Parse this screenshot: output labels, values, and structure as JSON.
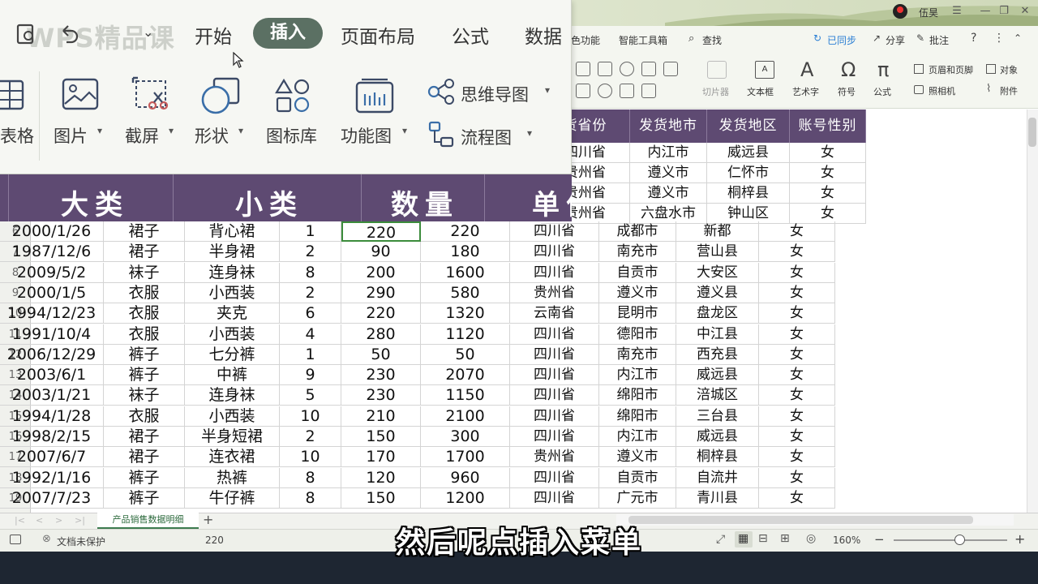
{
  "titlebar": {
    "user": "伍昊"
  },
  "ribbon_small": {
    "tabs": [
      "色功能",
      "智能工具箱",
      "查找",
      "已同步",
      "分享",
      "批注"
    ],
    "tools": [
      "切片器",
      "文本框",
      "艺术字",
      "符号",
      "公式"
    ],
    "right_tools": [
      "页眉和页脚",
      "对象",
      "照相机",
      "附件"
    ]
  },
  "zoom": {
    "watermark": "WPS精品课",
    "tabs": {
      "start": "开始",
      "insert": "插入",
      "layout": "页面布局",
      "formula": "公式",
      "data": "数据"
    },
    "tools": {
      "table": "表格",
      "picture": "图片",
      "screenshot": "截屏",
      "shape": "形状",
      "iconlib": "图标库",
      "funcchart": "功能图",
      "mindmap": "思维导图",
      "flowchart": "流程图"
    },
    "headers": [
      "大类",
      "小类",
      "数量",
      "单价"
    ]
  },
  "right_headers": [
    "货省份",
    "发货地市",
    "发货地区",
    "账号性别"
  ],
  "top_right_rows": [
    [
      "四川省",
      "内江市",
      "威远县",
      "女"
    ],
    [
      "贵州省",
      "遵义市",
      "仁怀市",
      "女"
    ],
    [
      "贵州省",
      "遵义市",
      "桐梓县",
      "女"
    ],
    [
      "贵州省",
      "六盘水市",
      "钟山区",
      "女"
    ]
  ],
  "rows": [
    {
      "n": "6",
      "date": "2000/1/26",
      "cat": "裙子",
      "sub": "背心裙",
      "qty": "1",
      "price": "220",
      "total": "220",
      "prov": "四川省",
      "city": "成都市",
      "dist": "新都",
      "sex": "女"
    },
    {
      "n": "7",
      "date": "1987/12/6",
      "cat": "裙子",
      "sub": "半身裙",
      "qty": "2",
      "price": "90",
      "total": "180",
      "prov": "四川省",
      "city": "南充市",
      "dist": "营山县",
      "sex": "女"
    },
    {
      "n": "8",
      "date": "2009/5/2",
      "cat": "袜子",
      "sub": "连身袜",
      "qty": "8",
      "price": "200",
      "total": "1600",
      "prov": "四川省",
      "city": "自贡市",
      "dist": "大安区",
      "sex": "女"
    },
    {
      "n": "9",
      "date": "2000/1/5",
      "cat": "衣服",
      "sub": "小西装",
      "qty": "2",
      "price": "290",
      "total": "580",
      "prov": "贵州省",
      "city": "遵义市",
      "dist": "遵义县",
      "sex": "女"
    },
    {
      "n": "10",
      "date": "1994/12/23",
      "cat": "衣服",
      "sub": "夹克",
      "qty": "6",
      "price": "220",
      "total": "1320",
      "prov": "云南省",
      "city": "昆明市",
      "dist": "盘龙区",
      "sex": "女"
    },
    {
      "n": "11",
      "date": "1991/10/4",
      "cat": "衣服",
      "sub": "小西装",
      "qty": "4",
      "price": "280",
      "total": "1120",
      "prov": "四川省",
      "city": "德阳市",
      "dist": "中江县",
      "sex": "女"
    },
    {
      "n": "12",
      "date": "2006/12/29",
      "cat": "裤子",
      "sub": "七分裤",
      "qty": "1",
      "price": "50",
      "total": "50",
      "prov": "四川省",
      "city": "南充市",
      "dist": "西充县",
      "sex": "女"
    },
    {
      "n": "13",
      "date": "2003/6/1",
      "cat": "裤子",
      "sub": "中裤",
      "qty": "9",
      "price": "230",
      "total": "2070",
      "prov": "四川省",
      "city": "内江市",
      "dist": "威远县",
      "sex": "女"
    },
    {
      "n": "14",
      "date": "2003/1/21",
      "cat": "袜子",
      "sub": "连身袜",
      "qty": "5",
      "price": "230",
      "total": "1150",
      "prov": "四川省",
      "city": "绵阳市",
      "dist": "涪城区",
      "sex": "女"
    },
    {
      "n": "15",
      "date": "1994/1/28",
      "cat": "衣服",
      "sub": "小西装",
      "qty": "10",
      "price": "210",
      "total": "2100",
      "prov": "四川省",
      "city": "绵阳市",
      "dist": "三台县",
      "sex": "女"
    },
    {
      "n": "16",
      "date": "1998/2/15",
      "cat": "裙子",
      "sub": "半身短裙",
      "qty": "2",
      "price": "150",
      "total": "300",
      "prov": "四川省",
      "city": "内江市",
      "dist": "威远县",
      "sex": "女"
    },
    {
      "n": "17",
      "date": "2007/6/7",
      "cat": "裙子",
      "sub": "连衣裙",
      "qty": "10",
      "price": "170",
      "total": "1700",
      "prov": "贵州省",
      "city": "遵义市",
      "dist": "桐梓县",
      "sex": "女"
    },
    {
      "n": "18",
      "date": "1992/1/16",
      "cat": "裤子",
      "sub": "热裤",
      "qty": "8",
      "price": "120",
      "total": "960",
      "prov": "四川省",
      "city": "自贡市",
      "dist": "自流井",
      "sex": "女"
    },
    {
      "n": "19",
      "date": "2007/7/23",
      "cat": "裤子",
      "sub": "牛仔裤",
      "qty": "8",
      "price": "150",
      "total": "1200",
      "prov": "四川省",
      "city": "广元市",
      "dist": "青川县",
      "sex": "女"
    }
  ],
  "sheet_tab": "产品销售数据明细",
  "status": {
    "protect": "文档未保护",
    "cell_value": "220",
    "zoom": "160%"
  },
  "subtitle": "然后呢点插入菜单",
  "colors": {
    "header_purple": "#5e4a72",
    "active_tab": "#5b7063",
    "selection": "#3c8c3c"
  }
}
